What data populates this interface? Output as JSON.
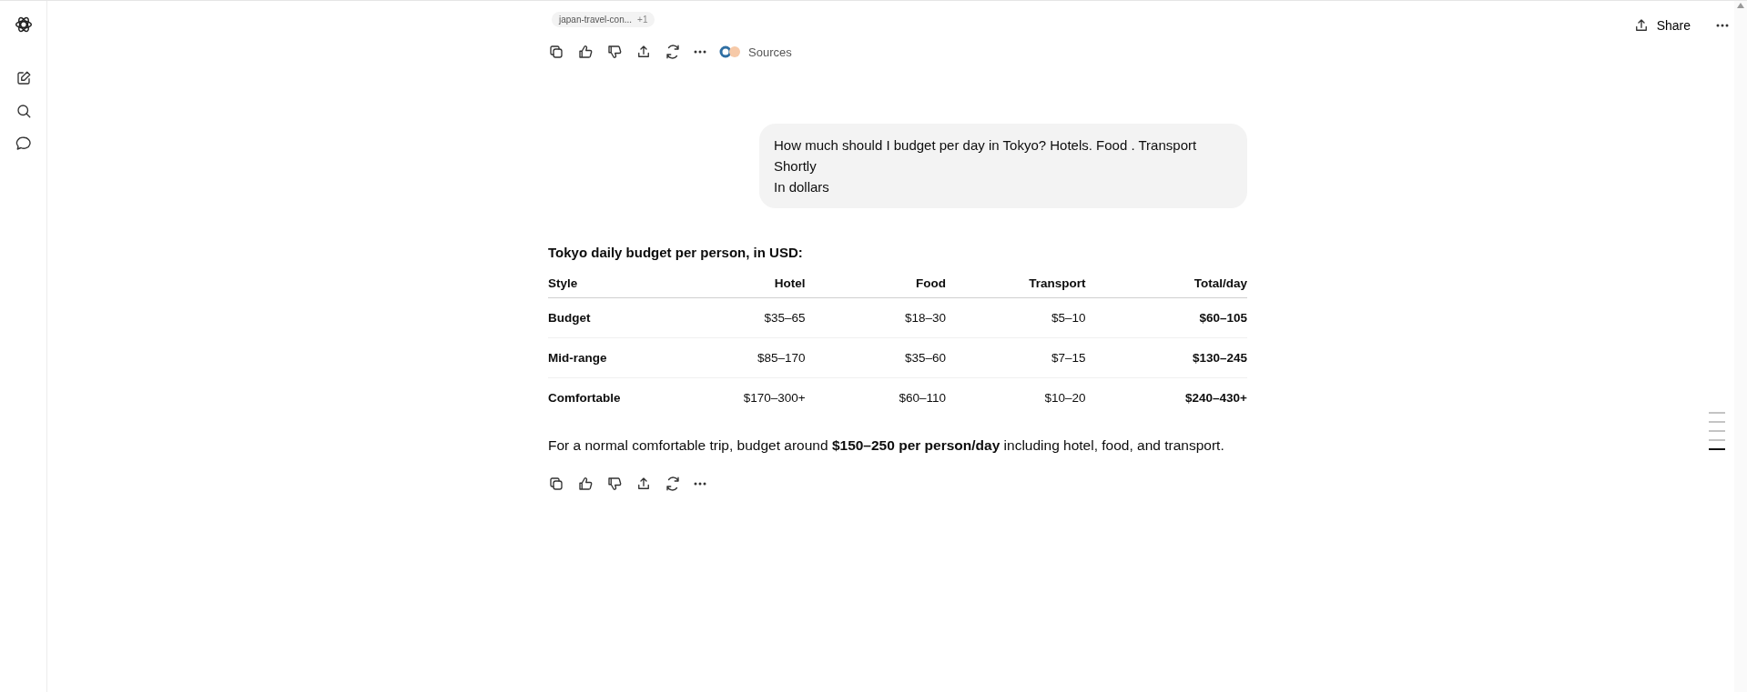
{
  "header": {
    "share_label": "Share"
  },
  "previous_answer": {
    "source_chip": {
      "label": "japan-travel-con...",
      "count": "+1"
    },
    "sources_label": "Sources"
  },
  "user_message": {
    "lines": [
      "How much should I budget per day in Tokyo? Hotels. Food . Transport",
      "Shortly",
      "In dollars"
    ]
  },
  "answer": {
    "heading": "Tokyo daily budget per person, in USD:",
    "table": {
      "columns": [
        "Style",
        "Hotel",
        "Food",
        "Transport",
        "Total/day"
      ],
      "rows": [
        [
          "Budget",
          "$35–65",
          "$18–30",
          "$5–10",
          "$60–105"
        ],
        [
          "Mid-range",
          "$85–170",
          "$35–60",
          "$7–15",
          "$130–245"
        ],
        [
          "Comfortable",
          "$170–300+",
          "$60–110",
          "$10–20",
          "$240–430+"
        ]
      ]
    },
    "summary": "For a normal comfortable trip, budget around **$150–250 per person/day** including hotel, food, and transport."
  },
  "scroll_markers": [
    {
      "selected": false
    },
    {
      "selected": false
    },
    {
      "selected": false
    },
    {
      "selected": false
    },
    {
      "selected": true
    }
  ]
}
